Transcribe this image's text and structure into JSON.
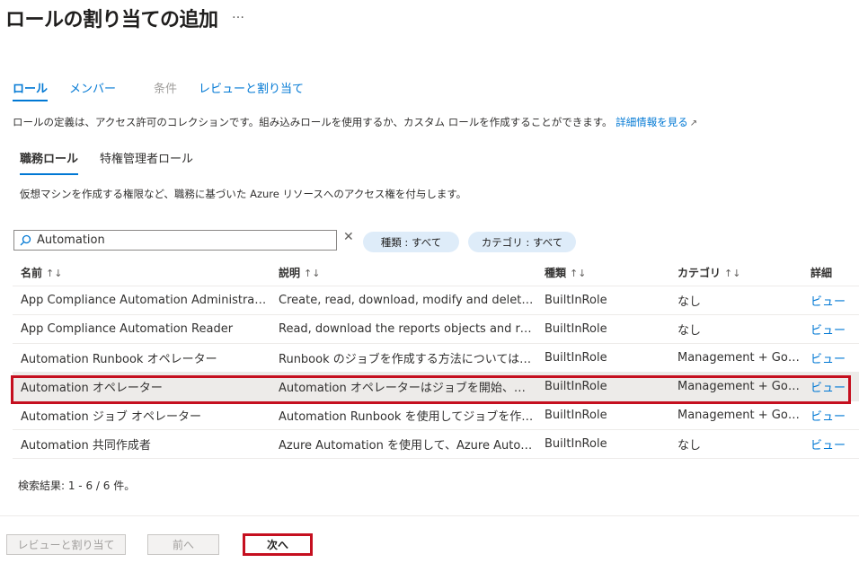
{
  "header": {
    "title": "ロールの割り当ての追加",
    "more": "…"
  },
  "wizard_tabs": [
    {
      "label": "ロール"
    },
    {
      "label": "メンバー"
    },
    {
      "label": "条件"
    },
    {
      "label": "レビューと割り当て"
    }
  ],
  "description": {
    "text": "ロールの定義は、アクセス許可のコレクションです。組み込みロールを使用するか、カスタム ロールを作成することができます。",
    "link": "詳細情報を見る"
  },
  "role_tabs": [
    {
      "label": "職務ロール"
    },
    {
      "label": "特権管理者ロール"
    }
  ],
  "role_description": "仮想マシンを作成する権限など、職務に基づいた Azure リソースへのアクセス権を付与します。",
  "search": {
    "value": "Automation",
    "placeholder": ""
  },
  "filters": {
    "type": "種類 : すべて",
    "category": "カテゴリ : すべて"
  },
  "table": {
    "headers": {
      "name": "名前",
      "description": "説明",
      "type": "種類",
      "category": "カテゴリ",
      "details": "詳細"
    },
    "sort_glyph": "↑↓",
    "rows": [
      {
        "name": "App Compliance Automation Administrator",
        "description": "Create, read, download, modify and delete…",
        "type": "BuiltInRole",
        "category": "なし",
        "details": "ビュー"
      },
      {
        "name": "App Compliance Automation Reader",
        "description": "Read, download the reports objects and rel…",
        "type": "BuiltInRole",
        "category": "なし",
        "details": "ビュー"
      },
      {
        "name": "Automation Runbook オペレーター",
        "description": "Runbook のジョブを作成する方法については、Runb…",
        "type": "BuiltInRole",
        "category": "Management + Gov…",
        "details": "ビュー"
      },
      {
        "name": "Automation オペレーター",
        "description": "Automation オペレーターはジョブを開始、停止、中…",
        "type": "BuiltInRole",
        "category": "Management + Gov…",
        "details": "ビュー"
      },
      {
        "name": "Automation ジョブ オペレーター",
        "description": "Automation Runbook を使用してジョブを作成お…",
        "type": "BuiltInRole",
        "category": "Management + Gov…",
        "details": "ビュー"
      },
      {
        "name": "Automation 共同作成者",
        "description": "Azure Automation を使用して、Azure Automa…",
        "type": "BuiltInRole",
        "category": "なし",
        "details": "ビュー"
      }
    ]
  },
  "result_count": "検索結果: 1 - 6 / 6 件。",
  "footer": {
    "review": "レビューと割り当て",
    "prev": "前へ",
    "next": "次へ"
  },
  "colors": {
    "accent": "#0078d4",
    "highlight": "#c50f1f"
  }
}
